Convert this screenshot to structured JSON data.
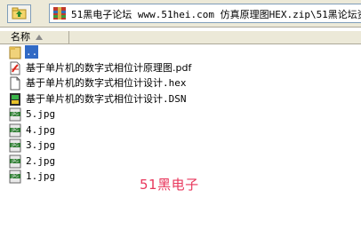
{
  "address_bar": {
    "path": "51黑电子论坛 www.51hei.com 仿真原理图HEX.zip\\51黑论坛资"
  },
  "list_header": {
    "name_column": "名称"
  },
  "files": [
    {
      "name": "..",
      "icon": "folder-up-icon"
    },
    {
      "name": "基于单片机的数字式相位计原理图.pdf",
      "icon": "pdf-file-icon"
    },
    {
      "name": "基于单片机的数字式相位计设计.hex",
      "icon": "generic-file-icon"
    },
    {
      "name": "基于单片机的数字式相位计设计.DSN",
      "icon": "dsn-file-icon"
    },
    {
      "name": "5.jpg",
      "icon": "jpg-file-icon"
    },
    {
      "name": "4.jpg",
      "icon": "jpg-file-icon"
    },
    {
      "name": "3.jpg",
      "icon": "jpg-file-icon"
    },
    {
      "name": "2.jpg",
      "icon": "jpg-file-icon"
    },
    {
      "name": "1.jpg",
      "icon": "jpg-file-icon"
    }
  ],
  "watermark": "51黑电子",
  "colors": {
    "selection": "#316ac5",
    "watermark": "#e8375c",
    "toolbar": "#ece9d8"
  }
}
